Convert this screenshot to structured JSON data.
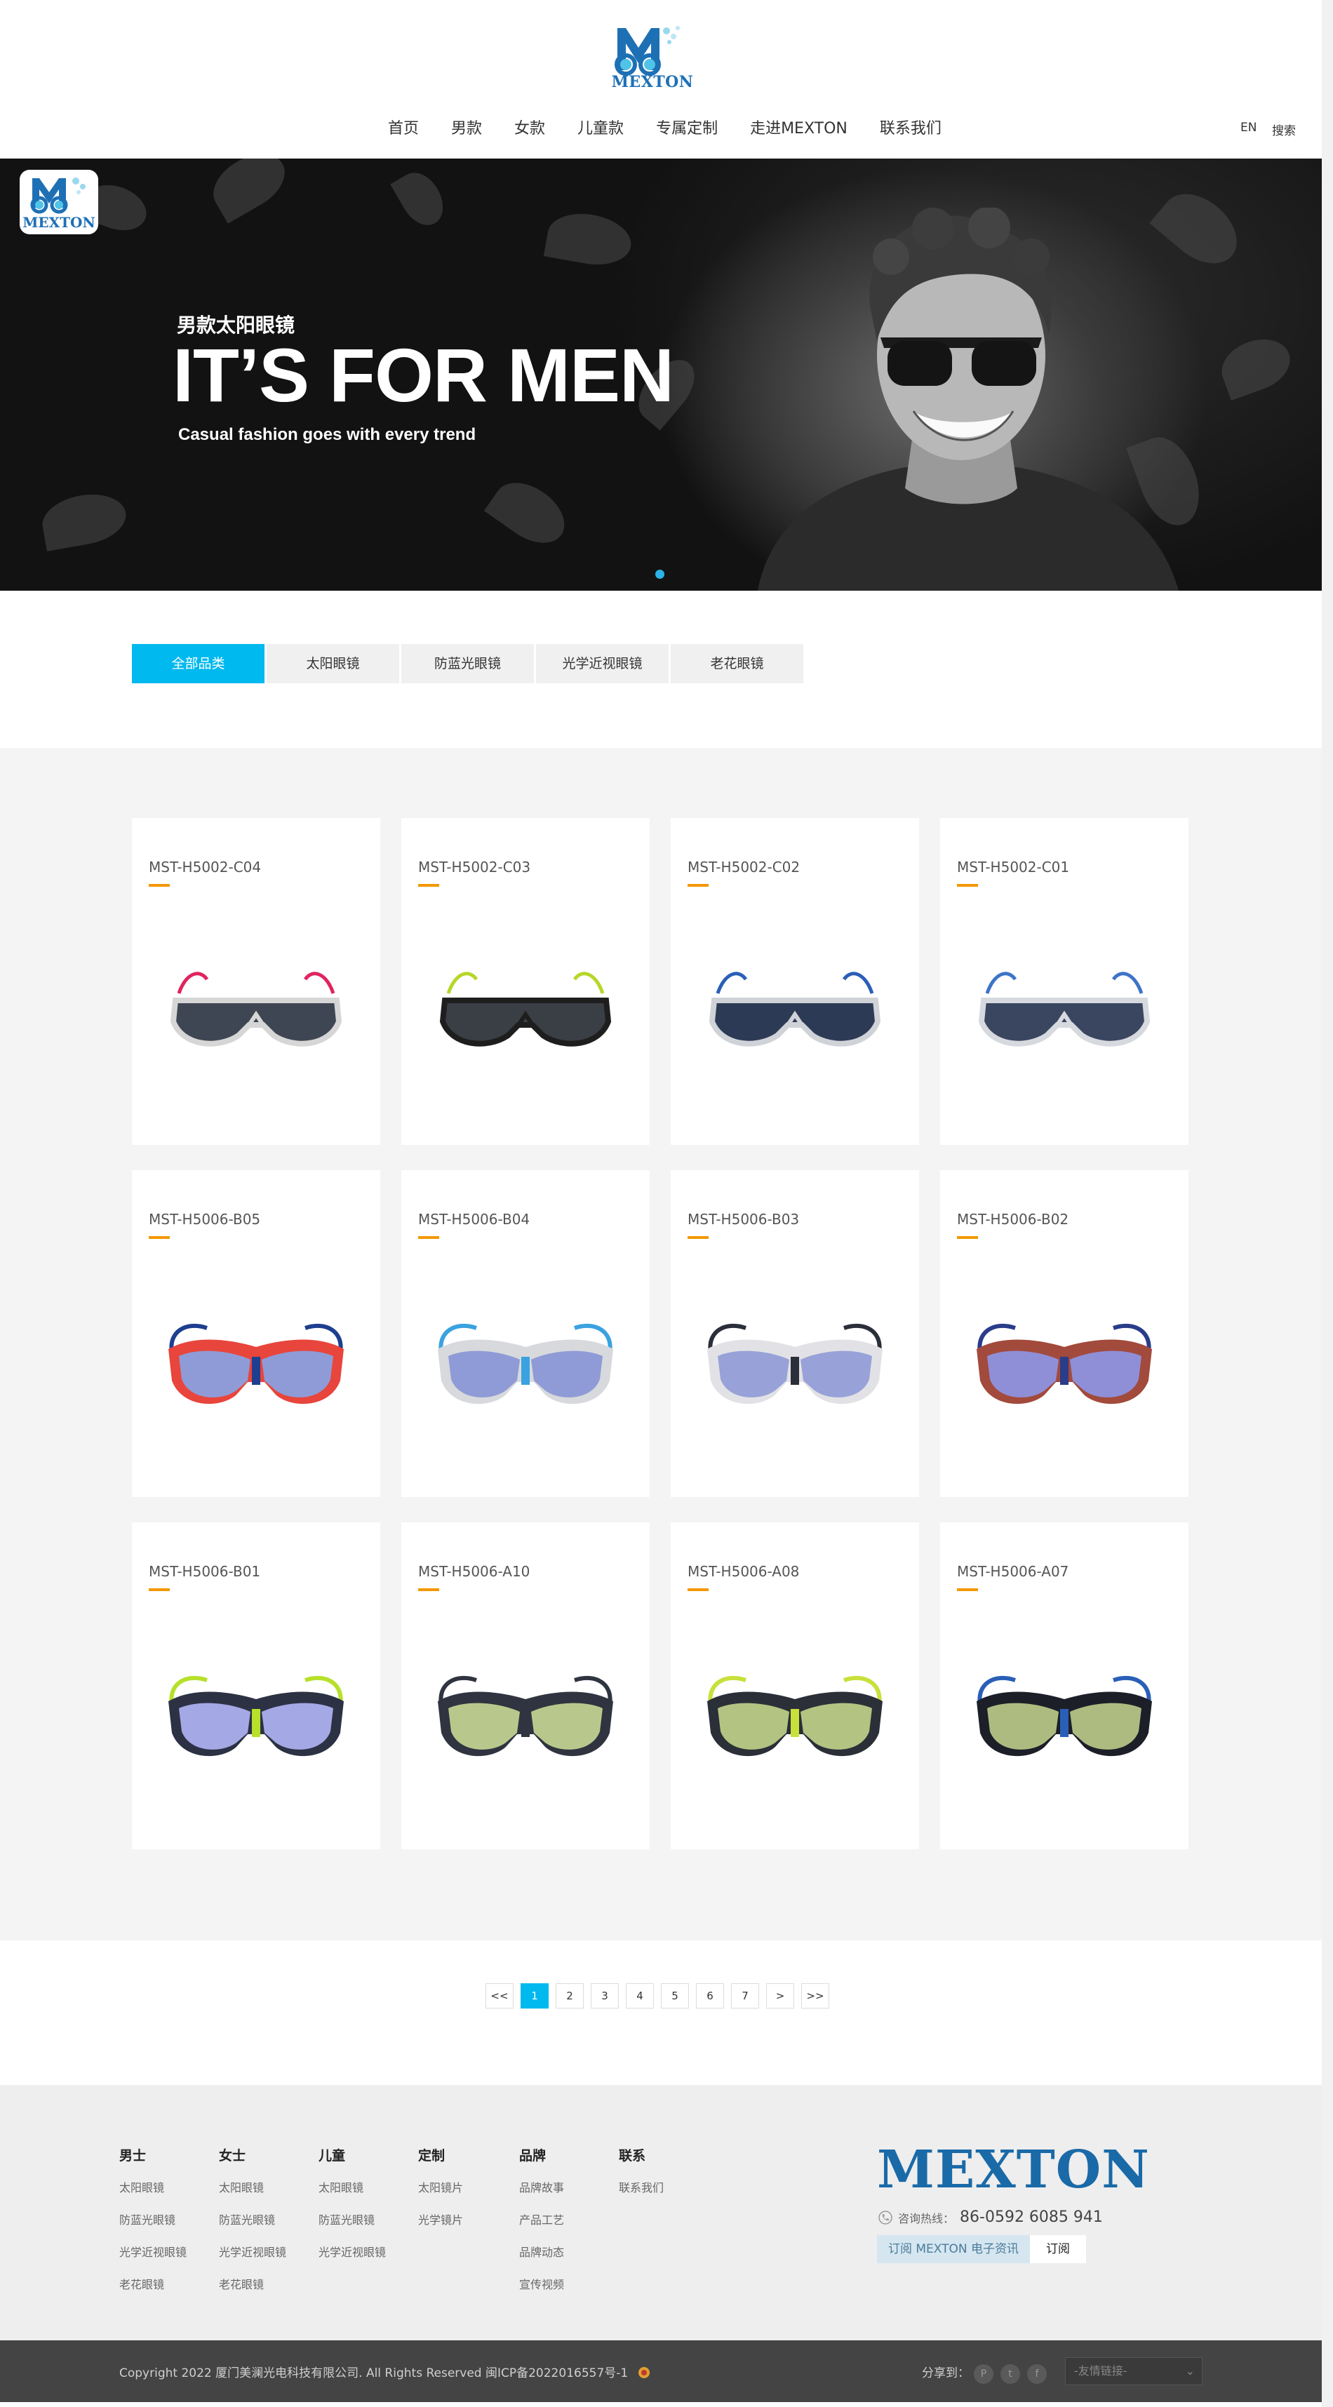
{
  "header": {
    "logo_text": "MEXTON",
    "nav": [
      "首页",
      "男款",
      "女款",
      "儿童款",
      "专属定制",
      "走进MEXTON",
      "联系我们"
    ],
    "lang": "EN",
    "search": "搜索"
  },
  "banner": {
    "logo_text": "MEXTON",
    "subtitle": "男款太阳眼镜",
    "title": "IT’S FOR MEN",
    "tagline": "Casual fashion goes with every trend"
  },
  "tabs": [
    "全部品类",
    "太阳眼镜",
    "防蓝光眼镜",
    "光学近视眼镜",
    "老花眼镜"
  ],
  "products": [
    {
      "code": "MST-H5002-C04",
      "frame": "#d6d6d6",
      "lens": "#3f4653",
      "temple": "#e0245e"
    },
    {
      "code": "MST-H5002-C03",
      "frame": "#1e1e1e",
      "lens": "#3a3e45",
      "temple": "#b6d629"
    },
    {
      "code": "MST-H5002-C02",
      "frame": "#cfd3d8",
      "lens": "#2d3a55",
      "temple": "#2a5fb8"
    },
    {
      "code": "MST-H5002-C01",
      "frame": "#d6d9de",
      "lens": "#3a4660",
      "temple": "#3d74c9"
    },
    {
      "code": "MST-H5006-B05",
      "frame": "#e8453c",
      "lens": "#8f9bd6",
      "temple": "#1e3f8f"
    },
    {
      "code": "MST-H5006-B04",
      "frame": "#d7d9dc",
      "lens": "#8f9bd6",
      "temple": "#3aa2e0"
    },
    {
      "code": "MST-H5006-B03",
      "frame": "#e2e2e6",
      "lens": "#98a2d8",
      "temple": "#2b2f3a"
    },
    {
      "code": "MST-H5006-B02",
      "frame": "#a24a3c",
      "lens": "#8f8fd8",
      "temple": "#2a3c8a"
    },
    {
      "code": "MST-H5006-B01",
      "frame": "#2c3244",
      "lens": "#a4a8e4",
      "temple": "#b6e02a"
    },
    {
      "code": "MST-H5006-A10",
      "frame": "#2f3440",
      "lens": "#b8c88c",
      "temple": "#2f3440"
    },
    {
      "code": "MST-H5006-A08",
      "frame": "#2a2f38",
      "lens": "#b3c382",
      "temple": "#c8e03a"
    },
    {
      "code": "MST-H5006-A07",
      "frame": "#1c1f28",
      "lens": "#aebb80",
      "temple": "#2a5fb8"
    }
  ],
  "pagination": [
    "<<",
    "1",
    "2",
    "3",
    "4",
    "5",
    "6",
    "7",
    ">",
    ">>"
  ],
  "footer": {
    "columns": [
      {
        "head": "男士",
        "links": [
          "太阳眼镜",
          "防蓝光眼镜",
          "光学近视眼镜",
          "老花眼镜"
        ]
      },
      {
        "head": "女士",
        "links": [
          "太阳眼镜",
          "防蓝光眼镜",
          "光学近视眼镜",
          "老花眼镜"
        ]
      },
      {
        "head": "儿童",
        "links": [
          "太阳眼镜",
          "防蓝光眼镜",
          "光学近视眼镜"
        ]
      },
      {
        "head": "定制",
        "links": [
          "太阳镜片",
          "光学镜片"
        ]
      },
      {
        "head": "品牌",
        "links": [
          "品牌故事",
          "产品工艺",
          "品牌动态",
          "宣传视频"
        ]
      },
      {
        "head": "联系",
        "links": [
          "联系我们"
        ]
      }
    ],
    "brand": "MEXTON",
    "hotline_label": "咨询热线：",
    "hotline": "86-0592 6085 941",
    "subscribe_label": "订阅 MEXTON 电子资讯",
    "subscribe_btn": "订阅"
  },
  "bottom": {
    "copyright": "Copyright 2022 厦门美澜光电科技有限公司. All Rights Reserved 闽ICP备2022016557号-1",
    "share": "分享到：",
    "friend_links": "-友情链接-"
  },
  "colors": {
    "accent": "#00b9ee",
    "brand": "#1a6aa8",
    "bar": "#f39800"
  }
}
